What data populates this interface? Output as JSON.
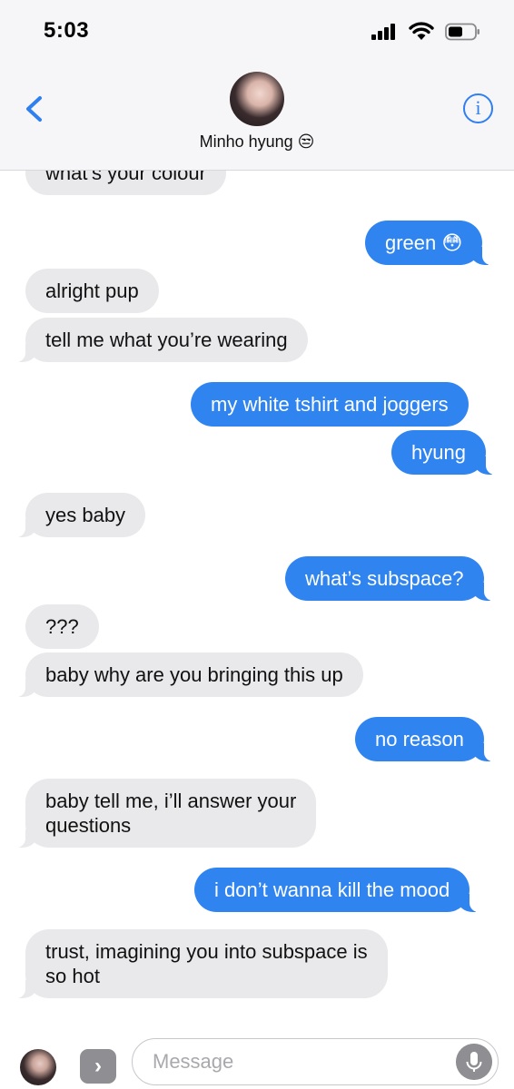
{
  "status_bar": {
    "time": "5:03",
    "icons": [
      "signal-icon",
      "wifi-icon",
      "battery-icon"
    ]
  },
  "header": {
    "contact_name": "Minho hyung 😒",
    "back_icon": "chevron-left-icon",
    "info_icon": "info-icon",
    "info_glyph": "i"
  },
  "colors": {
    "incoming_bubble": "#e9e9eb",
    "outgoing_bubble": "#2f84f0",
    "accent": "#2f7ff0"
  },
  "messages": [
    {
      "direction": "in",
      "text": "what’s your colour"
    },
    {
      "direction": "out",
      "text": "green 😳"
    },
    {
      "direction": "in",
      "text": "alright pup"
    },
    {
      "direction": "in",
      "text": "tell me what you’re wearing"
    },
    {
      "direction": "out",
      "text": "my white tshirt and joggers"
    },
    {
      "direction": "out",
      "text": "hyung"
    },
    {
      "direction": "in",
      "text": "yes baby"
    },
    {
      "direction": "out",
      "text": "what’s subspace?"
    },
    {
      "direction": "in",
      "text": "???"
    },
    {
      "direction": "in",
      "text": "baby why are you bringing this up"
    },
    {
      "direction": "out",
      "text": "no reason"
    },
    {
      "direction": "in",
      "text": "baby tell me, i’ll answer your\nquestions"
    },
    {
      "direction": "out",
      "text": "i don’t wanna kill the mood"
    },
    {
      "direction": "in",
      "text": "trust, imagining you into subspace is\nso hot"
    }
  ],
  "input_bar": {
    "placeholder": "Message",
    "apps_glyph": "›",
    "icons": [
      "avatar",
      "apps-chevron-icon",
      "microphone-icon"
    ]
  }
}
